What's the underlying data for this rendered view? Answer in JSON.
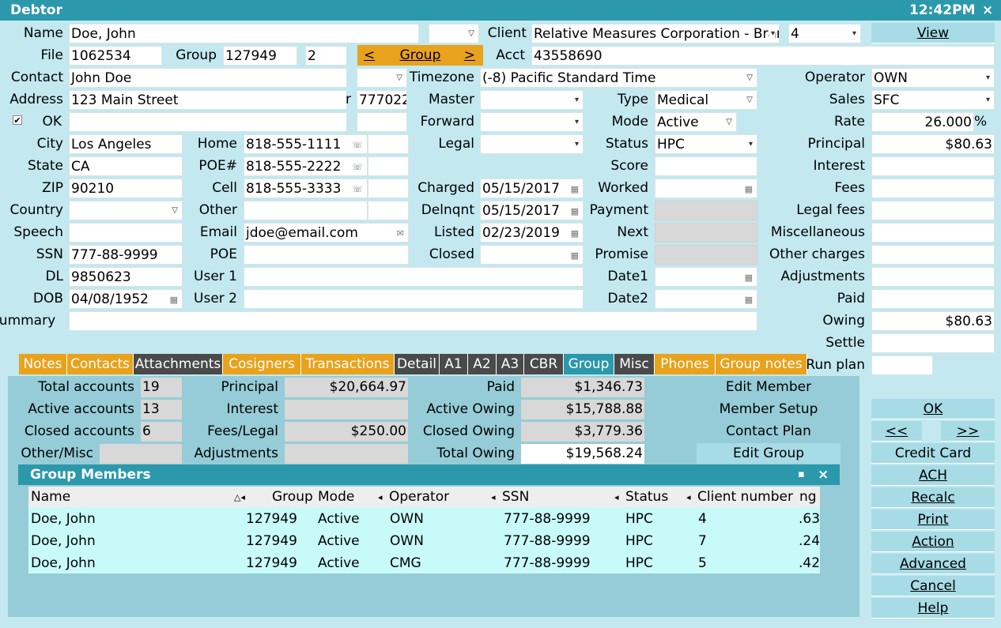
{
  "window": {
    "title": "Debtor",
    "time": "12:42PM",
    "close": "×"
  },
  "form": {
    "name_label": "Name",
    "name": "Doe, John",
    "client_label": "Client",
    "client": "Relative Measures Corporation - Brar",
    "client_num": "4",
    "file_label": "File",
    "file": "1062534",
    "group_label": "Group",
    "group": "127949",
    "group_count": "2",
    "acct_label": "Acct",
    "acct": "43558690",
    "contact_label": "Contact",
    "contact": "John Doe",
    "timezone_label": "Timezone",
    "timezone": "(-8) Pacific Standard Time",
    "operator_label": "Operator",
    "operator": "OWN",
    "address_label": "Address",
    "address": "123 Main Street",
    "addr_r": "r",
    "addr_code": "777022",
    "master_label": "Master",
    "type_label": "Type",
    "type": "Medical",
    "sales_label": "Sales",
    "sales": "SFC",
    "ok_check": "✔",
    "ok_label": "OK",
    "forward_label": "Forward",
    "mode_label": "Mode",
    "mode": "Active",
    "rate_label": "Rate",
    "rate": "26.000",
    "rate_unit": "%",
    "city_label": "City",
    "city": "Los Angeles",
    "home_label": "Home",
    "home": "818-555-1111",
    "legal_label": "Legal",
    "status_label": "Status",
    "status": "HPC",
    "principal_label": "Principal",
    "principal": "$80.63",
    "state_label": "State",
    "state": "CA",
    "poenum_label": "POE#",
    "poenum": "818-555-2222",
    "score_label": "Score",
    "interest_label": "Interest",
    "zip_label": "ZIP",
    "zip": "90210",
    "cell_label": "Cell",
    "cell": "818-555-3333",
    "charged_label": "Charged",
    "charged": "05/15/2017",
    "worked_label": "Worked",
    "fees_label": "Fees",
    "country_label": "Country",
    "other_label": "Other",
    "delnqnt_label": "Delnqnt",
    "delnqnt": "05/15/2017",
    "payment_label": "Payment",
    "legalfees_label": "Legal fees",
    "speech_label": "Speech",
    "email_label": "Email",
    "email": "jdoe@email.com",
    "listed_label": "Listed",
    "listed": "02/23/2019",
    "next_label": "Next",
    "misc_label": "Miscellaneous",
    "ssn_label": "SSN",
    "ssn": "777-88-9999",
    "poe_label": "POE",
    "closed_label": "Closed",
    "promise_label": "Promise",
    "othercharges_label": "Other charges",
    "dl_label": "DL",
    "dl": "9850623",
    "user1_label": "User 1",
    "date1_label": "Date1",
    "adjustments_label": "Adjustments",
    "dob_label": "DOB",
    "dob": "04/08/1952",
    "user2_label": "User 2",
    "date2_label": "Date2",
    "paid_label": "Paid",
    "summary_label": "Summary",
    "owing_label": "Owing",
    "owing": "$80.63",
    "settle_label": "Settle",
    "runplan_label": "Run plan",
    "group_nav_prev": "<",
    "group_nav_label": "Group",
    "group_nav_next": ">"
  },
  "buttons": {
    "view": "View",
    "ok": "OK",
    "prev": "<<",
    "next": ">>",
    "credit_card": "Credit Card",
    "ach": "ACH",
    "recalc": "Recalc",
    "print": "Print",
    "action": "Action",
    "advanced": "Advanced",
    "cancel": "Cancel",
    "help": "Help"
  },
  "tabs": [
    "Notes",
    "Contacts",
    "Attachments",
    "Cosigners",
    "Transactions",
    "Detail",
    "A1",
    "A2",
    "A3",
    "CBR",
    "Group",
    "Misc",
    "Phones",
    "Group notes"
  ],
  "summary": {
    "total_accounts_label": "Total accounts",
    "total_accounts": "19",
    "active_accounts_label": "Active accounts",
    "active_accounts": "13",
    "closed_accounts_label": "Closed accounts",
    "closed_accounts": "6",
    "other_misc_label": "Other/Misc",
    "principal_label": "Principal",
    "principal": "$20,664.97",
    "interest_label": "Interest",
    "fees_legal_label": "Fees/Legal",
    "fees_legal": "$250.00",
    "adjustments_label": "Adjustments",
    "paid_label": "Paid",
    "paid": "$1,346.73",
    "active_owing_label": "Active Owing",
    "active_owing": "$15,788.88",
    "closed_owing_label": "Closed Owing",
    "closed_owing": "$3,779.36",
    "total_owing_label": "Total Owing",
    "total_owing": "$19,568.24",
    "edit_member": "Edit Member",
    "member_setup": "Member Setup",
    "contact_plan": "Contact Plan",
    "edit_group": "Edit Group"
  },
  "group_members": {
    "title": "Group Members",
    "maximize": "▪",
    "close": "×",
    "headers": [
      "Name",
      "Group",
      "Mode",
      "Operator",
      "SSN",
      "Status",
      "Client number",
      "ng"
    ],
    "rows": [
      [
        "Doe, John",
        "127949",
        "Active",
        "OWN",
        "777-88-9999",
        "HPC",
        "4",
        ".63"
      ],
      [
        "Doe, John",
        "127949",
        "Active",
        "OWN",
        "777-88-9999",
        "HPC",
        "7",
        ".24"
      ],
      [
        "Doe, John",
        "127949",
        "Active",
        "CMG",
        "777-88-9999",
        "HPC",
        "5",
        ".42"
      ]
    ]
  },
  "colors": {
    "title": "#2b98ac",
    "orange": "#e9a21c",
    "dark": "#4a4a4a"
  }
}
